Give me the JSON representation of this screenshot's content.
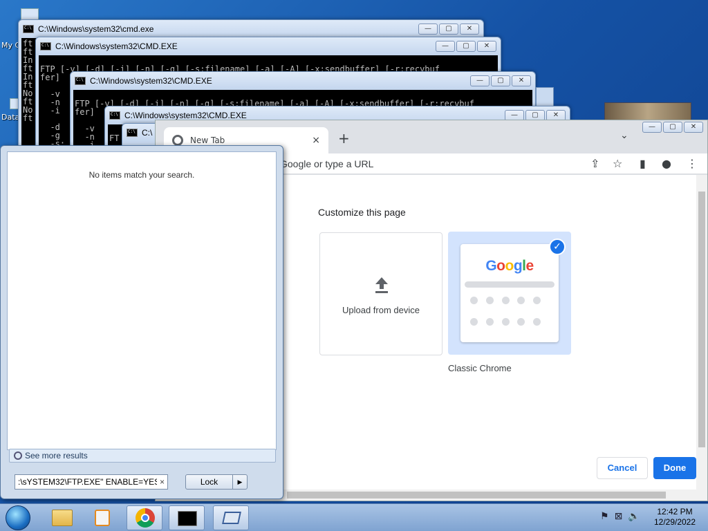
{
  "desktop": {
    "icon_labels": [
      "My C",
      "Data"
    ]
  },
  "cmd_windows": [
    {
      "title": "C:\\Windows\\system32\\cmd.exe",
      "lines": [
        "ft",
        "ft",
        "In",
        "ft",
        "In",
        "ft",
        "No",
        "ft",
        "No",
        "ft"
      ]
    },
    {
      "title": "C:\\Windows\\system32\\CMD.EXE",
      "lines": [
        "FTP [-v] [-d] [-i] [-n] [-g] [-s:filename] [-a] [-A] [-x:sendbuffer] [-r:recvbuf",
        "fer]",
        "",
        "  -v",
        "  -n",
        "  -i",
        "",
        "  -d",
        "  -g",
        "  -s:"
      ]
    },
    {
      "title": "C:\\Windows\\system32\\CMD.EXE",
      "lines": [
        "FTP [-v] [-d] [-i] [-n] [-g] [-s:filename] [-a] [-A] [-x:sendbuffer] [-r:recvbuf",
        "fer]",
        "",
        "  -v",
        "  -n",
        "  -i"
      ]
    },
    {
      "title": "C:\\Windows\\system32\\CMD.EXE",
      "lines": [
        "FT"
      ]
    },
    {
      "title": "C:\\"
    }
  ],
  "chrome": {
    "tab_title": "New Tab",
    "tab_close": "×",
    "new_tab": "+",
    "tab_dropdown": "⌄",
    "omnibox_placeholder": "Google or type a URL",
    "customize_title": "Customize this page",
    "upload_label": "Upload from device",
    "classic_label": "Classic Chrome",
    "google_logo": [
      "G",
      "o",
      "o",
      "g",
      "l",
      "e"
    ],
    "google_colors": [
      "#4285f4",
      "#ea4335",
      "#fbbc05",
      "#4285f4",
      "#34a853",
      "#ea4335"
    ],
    "check": "✓",
    "cancel": "Cancel",
    "done": "Done",
    "accent": "#1a73e8"
  },
  "startmenu": {
    "no_items": "No items match your search.",
    "see_more": "See more results",
    "search_value": ":\\sYSTEM32\\FTP.EXE\" ENABLE=YES\\",
    "search_clear": "×",
    "lock_label": "Lock",
    "lock_arrow": "▶"
  },
  "window_controls": {
    "min": "—",
    "max": "▢",
    "close": "✕"
  },
  "taskbar": {
    "time": "12:42 PM",
    "date": "12/29/2022"
  }
}
